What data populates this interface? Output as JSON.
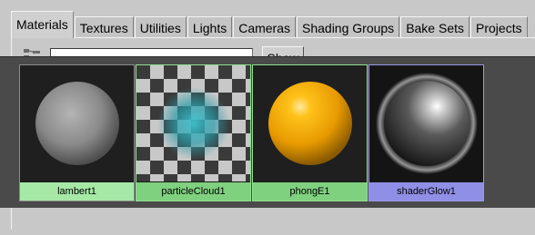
{
  "tabs": [
    {
      "label": "Materials",
      "active": true
    },
    {
      "label": "Textures",
      "active": false
    },
    {
      "label": "Utilities",
      "active": false
    },
    {
      "label": "Lights",
      "active": false
    },
    {
      "label": "Cameras",
      "active": false
    },
    {
      "label": "Shading Groups",
      "active": false
    },
    {
      "label": "Bake Sets",
      "active": false
    },
    {
      "label": "Projects",
      "active": false
    }
  ],
  "toolbar": {
    "filter_icon": "filter-icon",
    "search_value": "",
    "show_label": "Show"
  },
  "swatches": [
    {
      "label": "lambert1",
      "label_color": "#a6e8a6"
    },
    {
      "label": "particleCloud1",
      "label_color": "#7fd07f"
    },
    {
      "label": "phongE1",
      "label_color": "#7fd07f"
    },
    {
      "label": "shaderGlow1",
      "label_color": "#8f8fe6"
    }
  ]
}
